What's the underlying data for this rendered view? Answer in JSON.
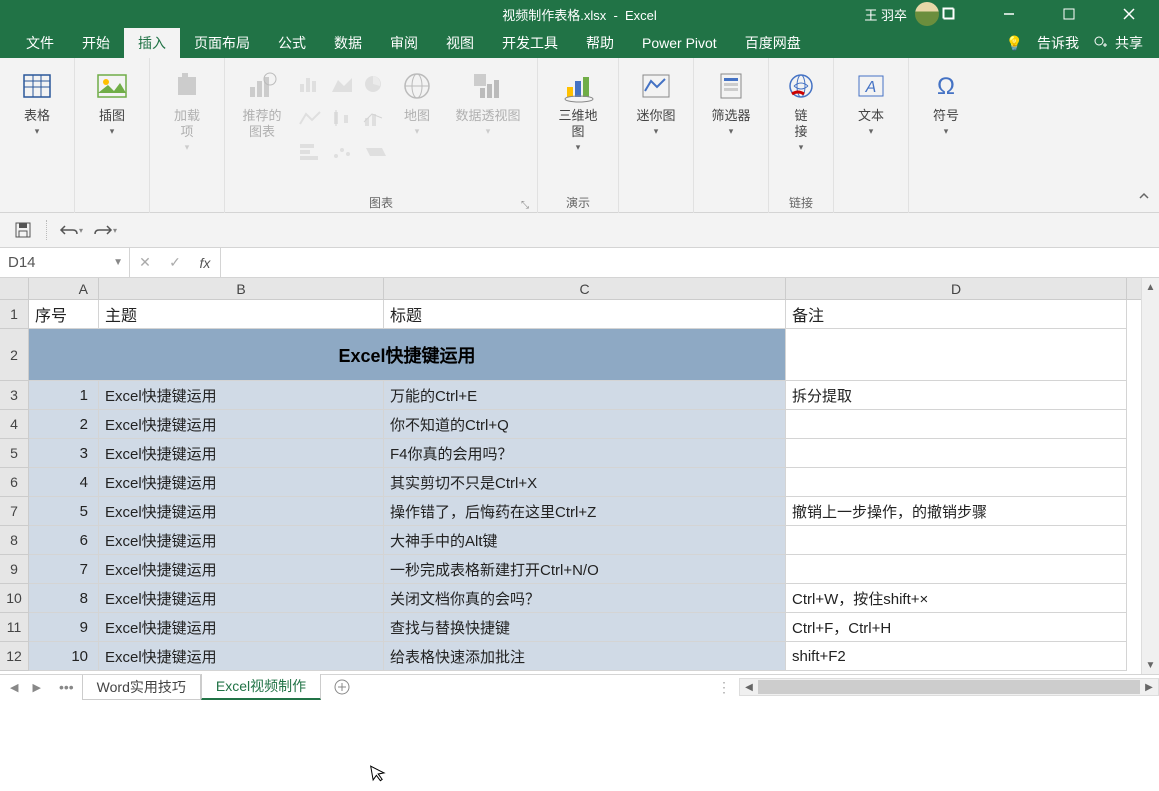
{
  "titlebar": {
    "filename": "视频制作表格.xlsx",
    "app": "Excel",
    "username": "王 羽卒"
  },
  "tabs": {
    "file": "文件",
    "home": "开始",
    "insert": "插入",
    "layout": "页面布局",
    "formula": "公式",
    "data": "数据",
    "review": "审阅",
    "view": "视图",
    "dev": "开发工具",
    "help": "帮助",
    "powerpivot": "Power Pivot",
    "baidu": "百度网盘",
    "tellme": "告诉我",
    "share": "共享"
  },
  "ribbon": {
    "table": "表格",
    "illustration": "插图",
    "addin": "加载\n项",
    "recommended": "推荐的\n图表",
    "map": "地图",
    "pivotchart": "数据透视图",
    "map3d": "三维地\n图",
    "sparkline": "迷你图",
    "slicer": "筛选器",
    "link": "链\n接",
    "text": "文本",
    "symbol": "符号",
    "grp_charts": "图表",
    "grp_demo": "演示",
    "grp_link": "链接"
  },
  "namebox": "D14",
  "columns": [
    "A",
    "B",
    "C",
    "D"
  ],
  "headers": {
    "a": "序号",
    "b": "主题",
    "c": "标题",
    "d": "备注"
  },
  "merged_title": "Excel快捷键运用",
  "rows": [
    {
      "n": "1",
      "b": "Excel快捷键运用",
      "c": "万能的Ctrl+E",
      "d": "拆分提取"
    },
    {
      "n": "2",
      "b": "Excel快捷键运用",
      "c": "你不知道的Ctrl+Q",
      "d": ""
    },
    {
      "n": "3",
      "b": "Excel快捷键运用",
      "c": "F4你真的会用吗？",
      "d": ""
    },
    {
      "n": "4",
      "b": "Excel快捷键运用",
      "c": "其实剪切不只是Ctrl+X",
      "d": ""
    },
    {
      "n": "5",
      "b": "Excel快捷键运用",
      "c": "操作错了，后悔药在这里Ctrl+Z",
      "d": "撤销上一步操作，的撤销步骤"
    },
    {
      "n": "6",
      "b": "Excel快捷键运用",
      "c": "大神手中的Alt键",
      "d": ""
    },
    {
      "n": "7",
      "b": "Excel快捷键运用",
      "c": "一秒完成表格新建打开Ctrl+N/O",
      "d": ""
    },
    {
      "n": "8",
      "b": "Excel快捷键运用",
      "c": "关闭文档你真的会吗？",
      "d": "Ctrl+W，按住shift+×"
    },
    {
      "n": "9",
      "b": "Excel快捷键运用",
      "c": "查找与替换快捷键",
      "d": "Ctrl+F，Ctrl+H"
    },
    {
      "n": "10",
      "b": "Excel快捷键运用",
      "c": "给表格快速添加批注",
      "d": "shift+F2"
    }
  ],
  "sheets": {
    "word": "Word实用技巧",
    "excel": "Excel视频制作"
  }
}
